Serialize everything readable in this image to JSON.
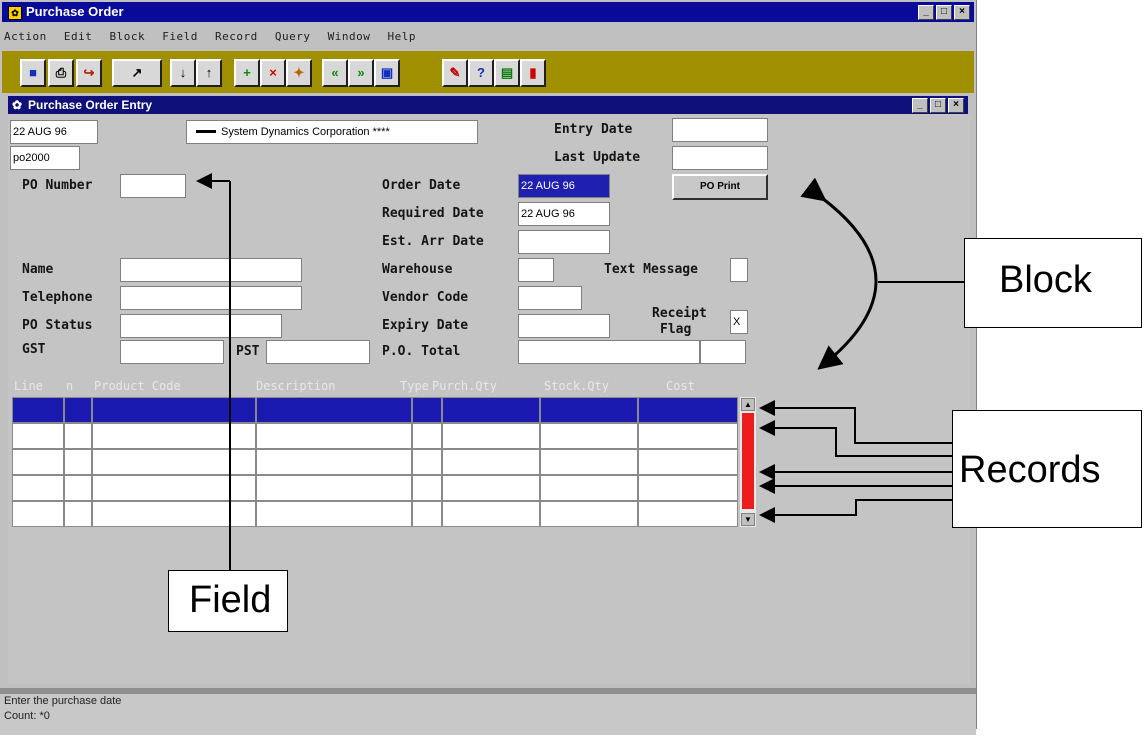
{
  "window": {
    "title": "Purchase Order",
    "app_icon": "form-app-icon",
    "controls": [
      "_",
      "□",
      "×"
    ]
  },
  "menu": [
    "Action",
    "Edit",
    "Block",
    "Field",
    "Record",
    "Query",
    "Window",
    "Help"
  ],
  "toolbar": {
    "background": "#a08f00",
    "buttons": [
      {
        "icon": "save-icon",
        "glyph": "■"
      },
      {
        "icon": "print-icon",
        "glyph": "⎙"
      },
      {
        "icon": "exit-icon",
        "glyph": "↪"
      },
      {
        "icon": "enter-query-icon",
        "glyph": "↗"
      },
      {
        "icon": "next-record-icon",
        "glyph": "↓"
      },
      {
        "icon": "previous-record-icon",
        "glyph": "↑"
      },
      {
        "icon": "insert-record-icon",
        "glyph": "+"
      },
      {
        "icon": "delete-record-icon",
        "glyph": "×"
      },
      {
        "icon": "duplicate-record-icon",
        "glyph": "✦"
      },
      {
        "icon": "first-record-icon",
        "glyph": "«"
      },
      {
        "icon": "last-record-icon",
        "glyph": "»"
      },
      {
        "icon": "list-values-icon",
        "glyph": "▣"
      },
      {
        "icon": "edit-icon",
        "glyph": "✎"
      },
      {
        "icon": "help-icon",
        "glyph": "?"
      },
      {
        "icon": "keys-icon",
        "glyph": "▤"
      },
      {
        "icon": "stop-icon",
        "glyph": "▮"
      }
    ]
  },
  "entry_window": {
    "title": "Purchase Order Entry",
    "controls": [
      "_",
      "□",
      "×"
    ]
  },
  "header": {
    "date": "22 AUG 96",
    "company": "System Dynamics Corporation ****",
    "po_ref": "po2000",
    "entry_date_label": "Entry  Date",
    "entry_date_value": "",
    "last_update_label": "Last Update",
    "last_update_value": ""
  },
  "fields": {
    "po_number": {
      "label": "PO Number",
      "value": ""
    },
    "order_date": {
      "label": "Order Date",
      "value": "22 AUG 96"
    },
    "required_date": {
      "label": "Required Date",
      "value": "22 AUG 96"
    },
    "est_arr_date": {
      "label": "Est. Arr Date",
      "value": ""
    },
    "name": {
      "label": "Name",
      "value": ""
    },
    "telephone": {
      "label": "Telephone",
      "value": ""
    },
    "po_status": {
      "label": "PO Status",
      "value": ""
    },
    "gst": {
      "label": "GST",
      "value": ""
    },
    "pst": {
      "label": "PST",
      "value": ""
    },
    "warehouse": {
      "label": "Warehouse",
      "value": ""
    },
    "vendor_code": {
      "label": "Vendor Code",
      "value": ""
    },
    "expiry_date": {
      "label": "Expiry Date",
      "value": ""
    },
    "po_total": {
      "label": "P.O. Total",
      "value": ""
    },
    "text_message": {
      "label": "Text Message",
      "value": ""
    },
    "receipt_flag": {
      "label_line1": "Receipt",
      "label_line2": "Flag",
      "value": "X"
    },
    "po_print_button": "PO Print"
  },
  "lines_table": {
    "columns": [
      "Line",
      "n",
      "Product Code",
      "Description",
      "Type",
      "Purch.Qty",
      "Stock.Qty",
      "Cost"
    ],
    "row_count": 5,
    "scrollbar_color": "#ee1d1d"
  },
  "status": {
    "message": "Enter the purchase date",
    "count": "Count: *0"
  },
  "annotations": {
    "block": "Block",
    "records": "Records",
    "field": "Field"
  }
}
